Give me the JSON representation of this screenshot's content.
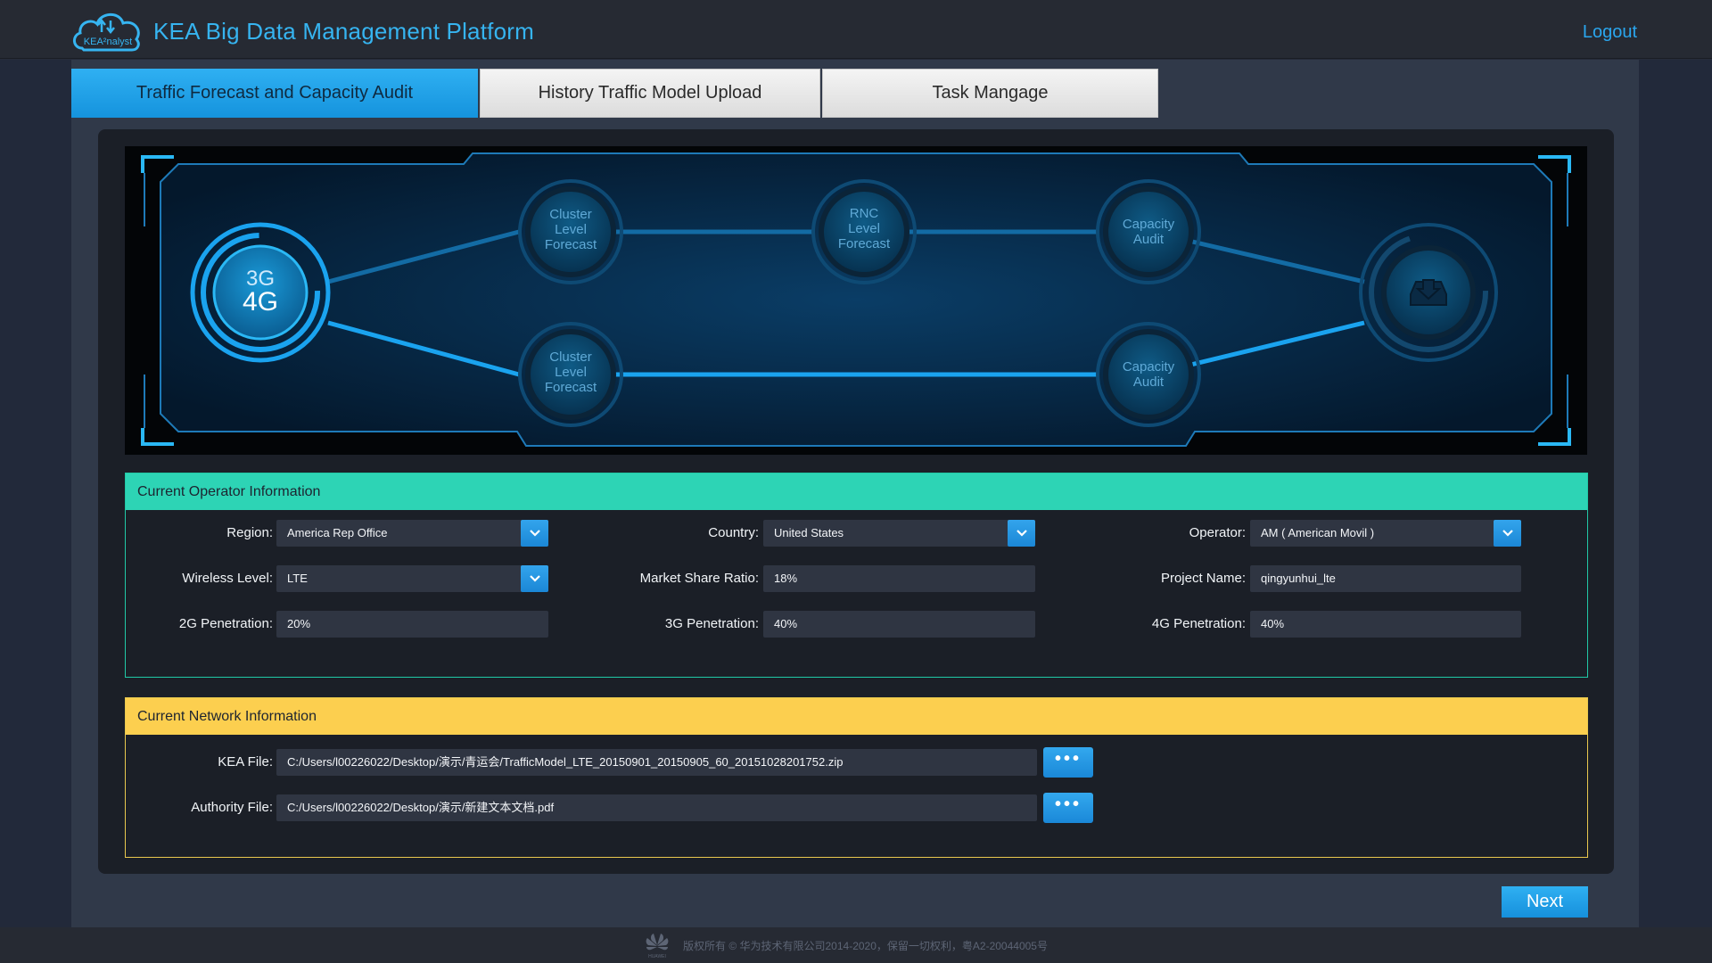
{
  "header": {
    "logo_text": "KEA²nalyst",
    "title": "KEA Big Data Management Platform",
    "logout_label": "Logout"
  },
  "tabs": [
    {
      "label": "Traffic Forecast and Capacity Audit",
      "active": true
    },
    {
      "label": "History Traffic Model Upload",
      "active": false
    },
    {
      "label": "Task Mangage",
      "active": false
    }
  ],
  "diagram": {
    "source_label_top": "3G",
    "source_label_bottom": "4G",
    "nodes": [
      {
        "lines": [
          "Cluster",
          "Level",
          "Forecast"
        ]
      },
      {
        "lines": [
          "RNC",
          "Level",
          "Forecast"
        ]
      },
      {
        "lines": [
          "Capacity",
          "Audit"
        ]
      },
      {
        "lines": [
          "Cluster",
          "Level",
          "Forecast"
        ]
      },
      {
        "lines": [
          "Capacity",
          "Audit"
        ]
      }
    ],
    "target_icon": "download-tray-icon"
  },
  "operator_section": {
    "title": "Current Operator Information",
    "fields": {
      "region": {
        "label": "Region:",
        "value": "America Rep Office"
      },
      "country": {
        "label": "Country:",
        "value": "United States"
      },
      "operator": {
        "label": "Operator:",
        "value": "AM ( American Movil )"
      },
      "wireless_level": {
        "label": "Wireless Level:",
        "value": "LTE"
      },
      "market_share": {
        "label": "Market Share Ratio:",
        "value": "18%"
      },
      "project_name": {
        "label": "Project Name:",
        "value": "qingyunhui_lte"
      },
      "pen_2g": {
        "label": "2G Penetration:",
        "value": "20%"
      },
      "pen_3g": {
        "label": "3G Penetration:",
        "value": "40%"
      },
      "pen_4g": {
        "label": "4G Penetration:",
        "value": "40%"
      }
    }
  },
  "network_section": {
    "title": "Current Network Information",
    "kea_file": {
      "label": "KEA File:",
      "value": "C:/Users/l00226022/Desktop/演示/青运会/TrafficModel_LTE_20150901_20150905_60_20151028201752.zip"
    },
    "authority_file": {
      "label": "Authority File:",
      "value": "C:/Users/l00226022/Desktop/演示/新建文本文档.pdf"
    },
    "browse_label": "•••"
  },
  "next_label": "Next",
  "footer": {
    "brand": "HUAWEI",
    "copyright": "版权所有 © 华为技术有限公司2014-2020，保留一切权利，粤A2-20044005号"
  },
  "colors": {
    "accent": "#2aa6ee",
    "operator_header": "#2dd4b5",
    "network_header": "#fccf4f"
  }
}
